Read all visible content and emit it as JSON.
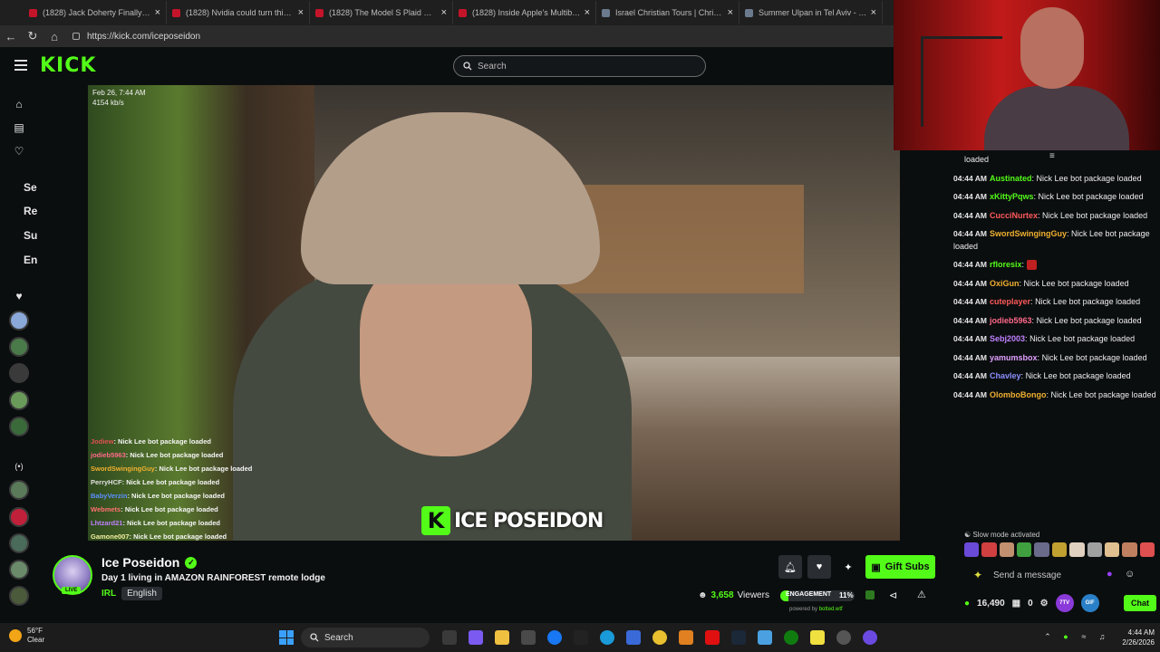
{
  "browser": {
    "tabs": [
      {
        "title": "(1828) Jack Doherty Finally Got H",
        "kind": "youtube"
      },
      {
        "title": "(1828) Nvidia could turn this whol",
        "kind": "youtube"
      },
      {
        "title": "(1828) The Model S Plaid Walked",
        "kind": "youtube"
      },
      {
        "title": "(1828) Inside Apple's Multibillion-",
        "kind": "youtube"
      },
      {
        "title": "Israel Christian Tours | Christian To",
        "kind": "web"
      },
      {
        "title": "Summer Ulpan in Tel Aviv - Learn",
        "kind": "web"
      }
    ],
    "tab_close": "×",
    "url": "https://kick.com/iceposeidon"
  },
  "kick": {
    "logo": "KICK",
    "search_placeholder": "Search",
    "sidebar_labels": [
      "Se",
      "Re",
      "Su",
      "En"
    ],
    "accent": "#53fc18"
  },
  "video": {
    "timestamp": "Feb 26, 7:44 AM",
    "bitrate": "4154 kb/s",
    "overlay_chat": [
      {
        "user": "Jodiew",
        "msg": "Nick Lee bot package loaded",
        "color": "#e05050"
      },
      {
        "user": "jodieb5963",
        "msg": "Nick Lee bot package loaded",
        "color": "#ff6a8a"
      },
      {
        "user": "SwordSwingingGuy",
        "msg": "Nick Lee bot package loaded",
        "color": "#f0b030"
      },
      {
        "user": "PerryHCF",
        "msg": "Nick Lee bot package loaded",
        "color": "#e0e0e0"
      },
      {
        "user": "BabyVerzin",
        "msg": "Nick Lee bot package loaded",
        "color": "#5a90ff"
      },
      {
        "user": "Webmets",
        "msg": "Nick Lee bot package loaded",
        "color": "#ff7070"
      },
      {
        "user": "Lhtzard21",
        "msg": "Nick Lee bot package loaded",
        "color": "#c080ff"
      },
      {
        "user": "Gamone007",
        "msg": "Nick Lee bot package loaded",
        "color": "#f0f0a0"
      }
    ],
    "brand_overlay": "ICE POSEIDON",
    "brand_k": "K"
  },
  "stream": {
    "name": "Ice Poseidon",
    "title": "Day 1 living in AMAZON RAINFOREST remote lodge",
    "category": "IRL",
    "language": "English",
    "live_label": "LIVE",
    "viewers": "3,658",
    "viewers_label": "Viewers",
    "engagement_label": "ENGAGEMENT",
    "engagement_pct": "11%",
    "engagement_value": 0.11,
    "powered_by": "powered by",
    "powered_brand": "botted.wtf",
    "gift_label": "Gift Subs"
  },
  "chat": {
    "first_line": "loaded",
    "messages": [
      {
        "time": "04:44 AM",
        "user": "Austinated",
        "text": "Nick Lee bot package loaded",
        "color": "#53fc18"
      },
      {
        "time": "04:44 AM",
        "user": "xKittyPqws",
        "text": "Nick Lee bot package loaded",
        "color": "#53fc18"
      },
      {
        "time": "04:44 AM",
        "user": "CucciNurtex",
        "text": "Nick Lee bot package loaded",
        "color": "#ff5a5a"
      },
      {
        "time": "04:44 AM",
        "user": "SwordSwingingGuy",
        "text": "Nick Lee bot package loaded",
        "color": "#f0b030"
      },
      {
        "time": "04:44 AM",
        "user": "rfloresix",
        "text": "",
        "color": "#53fc18"
      },
      {
        "time": "04:44 AM",
        "user": "OxiGun",
        "text": "Nick Lee bot package loaded",
        "color": "#f0b030"
      },
      {
        "time": "04:44 AM",
        "user": "cuteplayer",
        "text": "Nick Lee bot package loaded",
        "color": "#ff5a5a"
      },
      {
        "time": "04:44 AM",
        "user": "jodieb5963",
        "text": "Nick Lee bot package loaded",
        "color": "#ff6a8a"
      },
      {
        "time": "04:44 AM",
        "user": "Sebj2003",
        "text": "Nick Lee bot package loaded",
        "color": "#c080ff"
      },
      {
        "time": "04:44 AM",
        "user": "yamumsbox",
        "text": "Nick Lee bot package loaded",
        "color": "#e0a0ff"
      },
      {
        "time": "04:44 AM",
        "user": "Chavley",
        "text": "Nick Lee bot package loaded",
        "color": "#8a90ff"
      },
      {
        "time": "04:44 AM",
        "user": "OlomboBongo",
        "text": "Nick Lee bot package loaded",
        "color": "#f0b030"
      }
    ],
    "slow_mode": "Slow mode activated",
    "input_placeholder": "Send a message",
    "points": "16,490",
    "zero": "0",
    "chat_button": "Chat",
    "pill1": "7TV",
    "pill2": "GIF"
  },
  "taskbar": {
    "temp": "56°F",
    "weather": "Clear",
    "search": "Search",
    "time": "4:44 AM",
    "date": "2/26/2026"
  }
}
